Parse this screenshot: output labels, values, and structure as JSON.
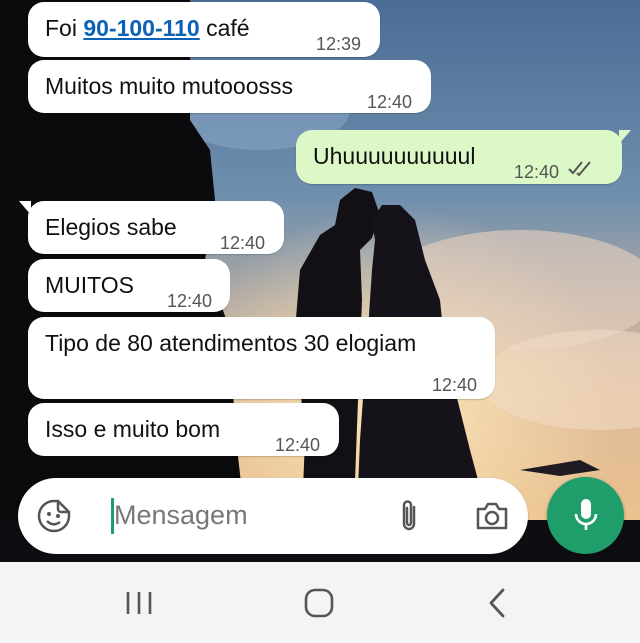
{
  "messages": [
    {
      "type": "in",
      "text_before": "Foi ",
      "link": "90-100-110",
      "text_after": " café",
      "time": "12:39"
    },
    {
      "type": "in",
      "text": "Muitos muito mutooosss",
      "time": "12:40"
    },
    {
      "type": "out",
      "text": "Uhuuuuuuuuuul",
      "time": "12:40",
      "status": "read"
    },
    {
      "type": "in",
      "text": "Elegios sabe",
      "time": "12:40"
    },
    {
      "type": "in",
      "text": "MUITOS",
      "time": "12:40"
    },
    {
      "type": "in",
      "text": "Tipo de 80 atendimentos 30 elogiam",
      "time": "12:40"
    },
    {
      "type": "in",
      "text": "Isso e muito bom",
      "time": "12:40"
    }
  ],
  "composer": {
    "placeholder": "Mensagem",
    "icons": [
      "sticker-icon",
      "attach-icon",
      "camera-icon",
      "mic-icon"
    ]
  },
  "navbar": {
    "icons": [
      "recent-apps-icon",
      "home-icon",
      "back-icon"
    ]
  },
  "colors": {
    "incoming": "#ffffff",
    "outgoing": "#dcf8c6",
    "accent": "#1f9d6a",
    "link": "#0b62b6"
  }
}
